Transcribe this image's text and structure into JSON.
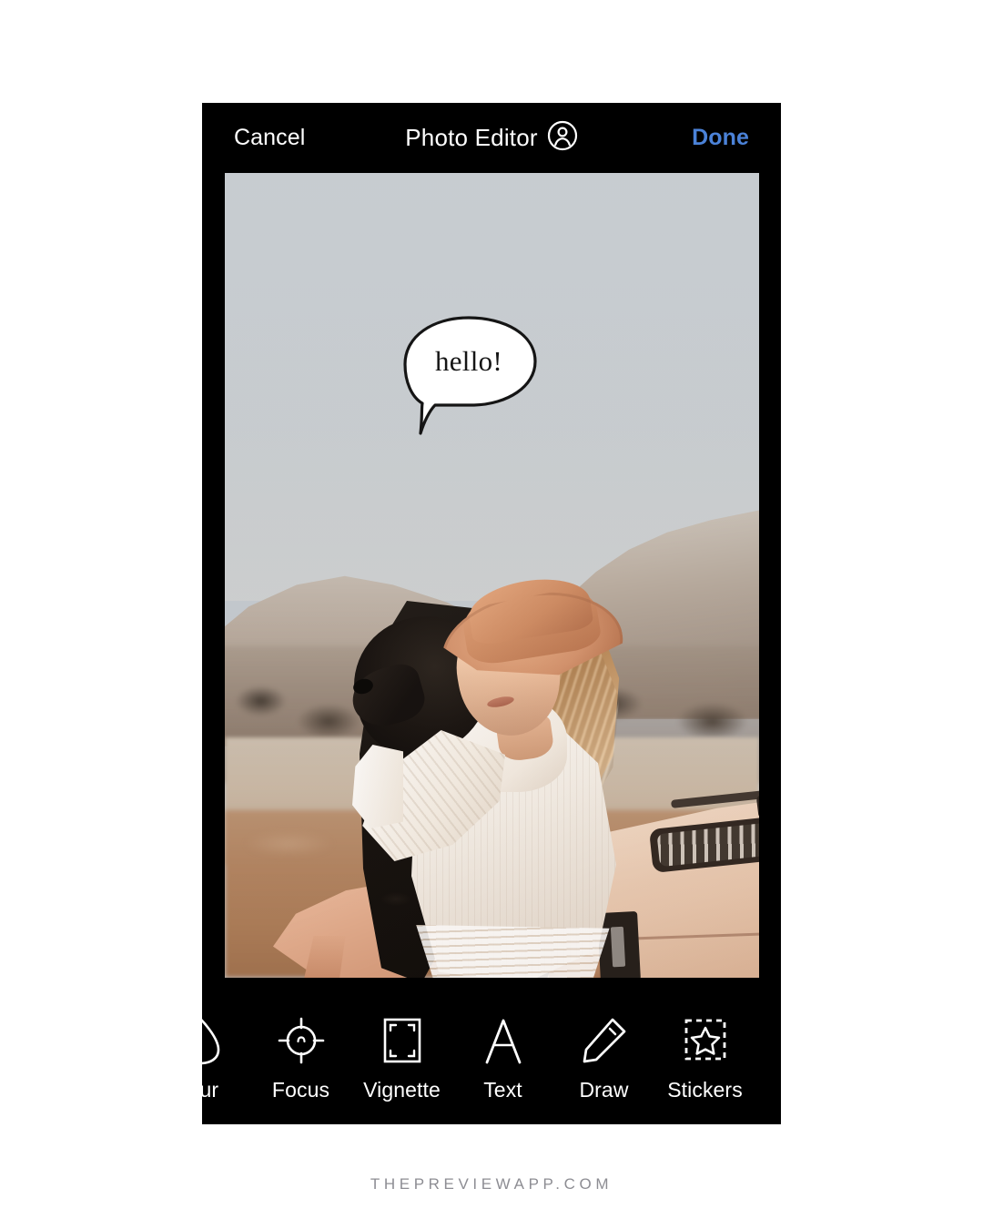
{
  "app": {
    "screen_name": "Photo Editor"
  },
  "header": {
    "cancel_label": "Cancel",
    "title": "Photo Editor",
    "account_icon": "person-circle-icon",
    "done_label": "Done",
    "done_color": "#4b82d8",
    "background_color": "#000000",
    "text_color": "#ffffff"
  },
  "photo": {
    "description": "Woman in tan wide-brim hat and white knit sweater sitting on the hood of a cream Jeep, holding a black curly-haired dog, dry golden hills and mountains behind",
    "sky_color": "#c4cad0",
    "ground_color": "#b0825f",
    "vehicle_color": "#eed3bd"
  },
  "stickers": [
    {
      "name": "speech-bubble-sticker",
      "text": "hello!",
      "stroke_color": "#151515",
      "fill_color": "#ffffff"
    }
  ],
  "toolbar": {
    "background_color": "#000000",
    "label_color": "#ffffff",
    "tools": [
      {
        "id": "blur",
        "label": "Blur",
        "icon": "droplet-icon",
        "clipped": true,
        "selected": false
      },
      {
        "id": "focus",
        "label": "Focus",
        "icon": "crosshair-icon",
        "clipped": false,
        "selected": false
      },
      {
        "id": "vignette",
        "label": "Vignette",
        "icon": "frame-corners-icon",
        "clipped": false,
        "selected": false
      },
      {
        "id": "text",
        "label": "Text",
        "icon": "letter-a-icon",
        "clipped": false,
        "selected": false
      },
      {
        "id": "draw",
        "label": "Draw",
        "icon": "pencil-icon",
        "clipped": false,
        "selected": false
      },
      {
        "id": "stickers",
        "label": "Stickers",
        "icon": "star-in-box-icon",
        "clipped": false,
        "selected": false
      }
    ]
  },
  "footer": {
    "watermark": "THEPREVIEWAPP.COM",
    "color": "#8d8d93"
  },
  "page": {
    "background_color": "#ffffff"
  }
}
